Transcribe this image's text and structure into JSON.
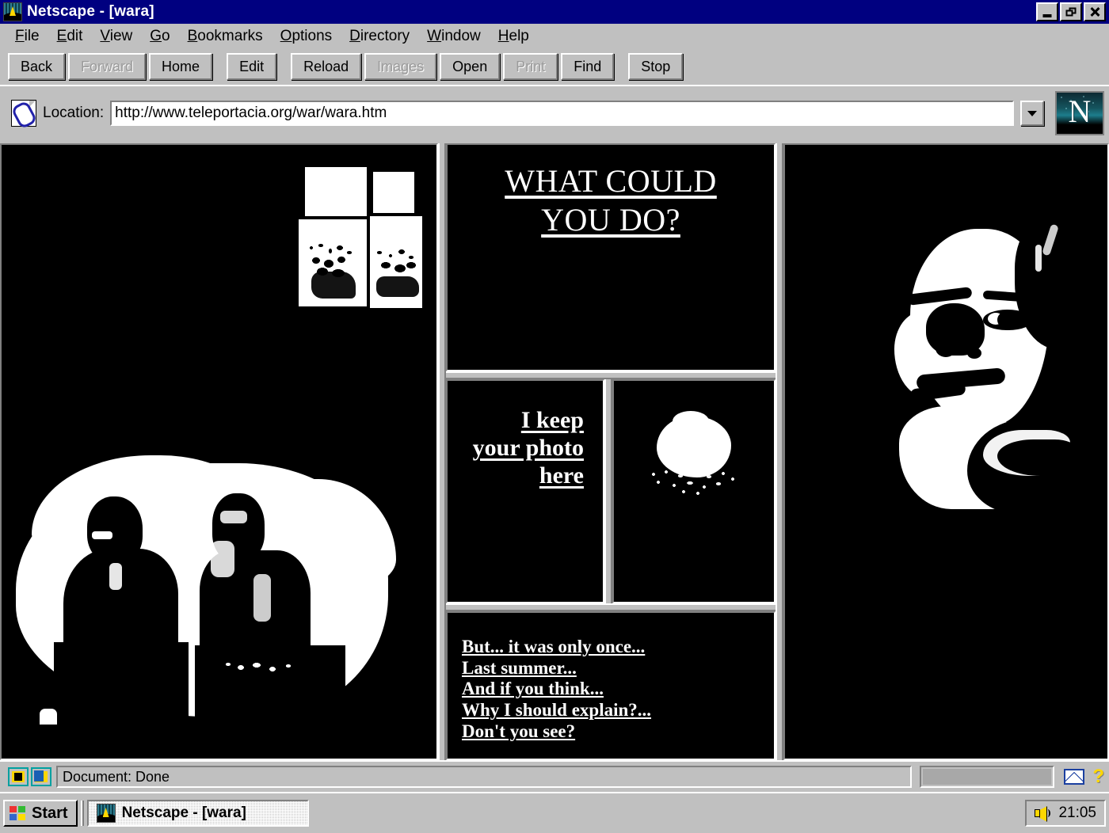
{
  "window": {
    "title": "Netscape - [wara]",
    "icon": "netscape-icon",
    "controls": {
      "minimize": "minimize-icon",
      "restore": "restore-icon",
      "close": "close-icon"
    }
  },
  "menu": {
    "items": [
      {
        "label": "File",
        "accel": "F"
      },
      {
        "label": "Edit",
        "accel": "E"
      },
      {
        "label": "View",
        "accel": "V"
      },
      {
        "label": "Go",
        "accel": "G"
      },
      {
        "label": "Bookmarks",
        "accel": "B"
      },
      {
        "label": "Options",
        "accel": "O"
      },
      {
        "label": "Directory",
        "accel": "D"
      },
      {
        "label": "Window",
        "accel": "W"
      },
      {
        "label": "Help",
        "accel": "H"
      }
    ]
  },
  "toolbar": {
    "buttons": [
      {
        "label": "Back",
        "enabled": true
      },
      {
        "label": "Forward",
        "enabled": false
      },
      {
        "label": "Home",
        "enabled": true
      },
      {
        "label": "Edit",
        "enabled": true
      },
      {
        "label": "Reload",
        "enabled": true
      },
      {
        "label": "Images",
        "enabled": false
      },
      {
        "label": "Open",
        "enabled": true
      },
      {
        "label": "Print",
        "enabled": false
      },
      {
        "label": "Find",
        "enabled": true
      },
      {
        "label": "Stop",
        "enabled": true
      }
    ]
  },
  "location": {
    "icon": "document-link-icon",
    "label": "Location:",
    "url": "http://www.teleportacia.org/war/wara.htm",
    "dropdown_icon": "chevron-down-icon",
    "brand_logo": "netscape-n-logo",
    "brand_letter": "N"
  },
  "page": {
    "heading_line1": "WHAT COULD",
    "heading_line2": "YOU DO?",
    "photo_link_line1": "I keep",
    "photo_link_line2": "your photo",
    "photo_link_line3": "here",
    "links": [
      "But... it was only once...",
      "Last summer...",
      "And if you think...",
      "Why I should explain?...",
      "Don't you see?"
    ],
    "images": {
      "left_top": "windows-photo-collage-image",
      "left_bottom": "two-figures-silhouette-image",
      "explosion": "explosion-cloud-image",
      "portrait": "face-portrait-image"
    },
    "colors": {
      "background": "#000000",
      "text": "#ffffff"
    }
  },
  "status": {
    "security_icon": "security-key-icon",
    "broken_key_icon": "broken-key-icon",
    "text": "Document: Done",
    "mail_icon": "mail-envelope-icon",
    "help_icon": "question-mark-icon"
  },
  "taskbar": {
    "start_label": "Start",
    "start_icon": "windows-flag-icon",
    "task_label": "Netscape - [wara]",
    "task_icon": "netscape-icon",
    "tray": {
      "volume_icon": "speaker-icon",
      "clock": "21:05"
    }
  }
}
